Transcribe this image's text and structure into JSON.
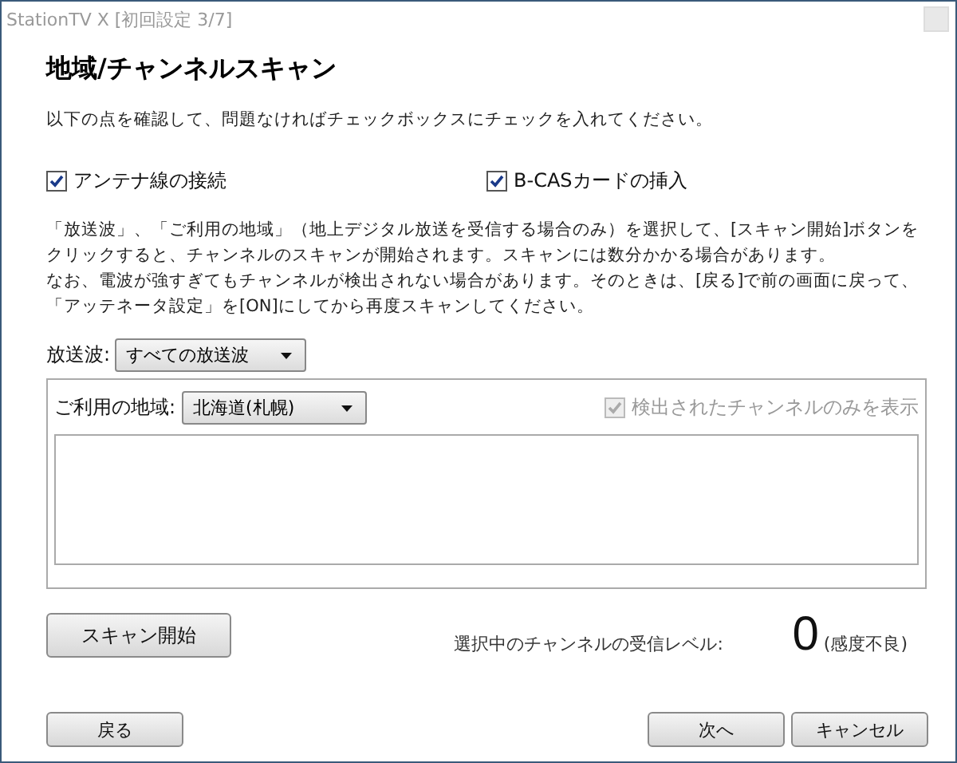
{
  "window": {
    "title": "StationTV X [初回設定 3/7]"
  },
  "heading": "地域/チャンネルスキャン",
  "instruction": "以下の点を確認して、問題なければチェックボックスにチェックを入れてください。",
  "checks": [
    {
      "label": "アンテナ線の接続",
      "checked": true
    },
    {
      "label": "B-CASカードの挿入",
      "checked": true
    }
  ],
  "notes": [
    "「放送波」、「ご利用の地域」（地上デジタル放送を受信する場合のみ）を選択して、[スキャン開始]ボタンをクリックすると、チャンネルのスキャンが開始されます。スキャンには数分かかる場合があります。",
    "なお、電波が強すぎてもチャンネルが検出されない場合があります。そのときは、[戻る]で前の画面に戻って、「アッテネータ設定」を[ON]にしてから再度スキャンしてください。"
  ],
  "broadcast": {
    "label": "放送波:",
    "value": "すべての放送波"
  },
  "region": {
    "label": "ご利用の地域:",
    "value": "北海道(札幌)"
  },
  "detected_only": {
    "label": "検出されたチャンネルのみを表示",
    "checked": true,
    "disabled": true
  },
  "scan_button": "スキャン開始",
  "signal": {
    "label": "選択中のチャンネルの受信レベル:",
    "value": "0",
    "status": "(感度不良)"
  },
  "buttons": {
    "back": "戻る",
    "next": "次へ",
    "cancel": "キャンセル"
  }
}
